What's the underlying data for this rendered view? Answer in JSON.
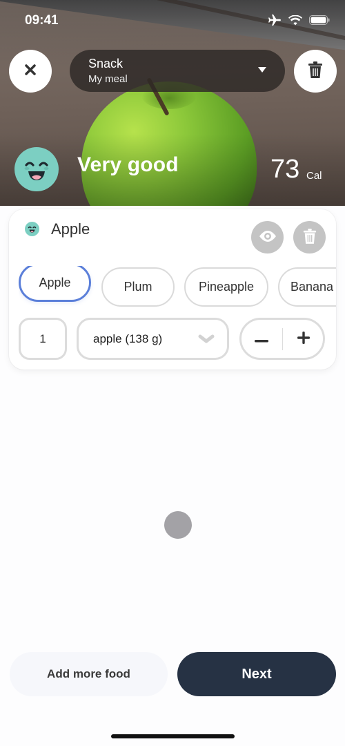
{
  "status_bar": {
    "time": "09:41",
    "icons": [
      "airplane-icon",
      "wifi-icon",
      "battery-icon"
    ]
  },
  "header": {
    "close_icon": "close-icon",
    "meal_type": "Snack",
    "meal_name": "My meal",
    "dropdown_icon": "caret-down-icon",
    "delete_icon": "trash-icon"
  },
  "summary": {
    "rating_icon": "happy-face-icon",
    "rating_label": "Very good",
    "calories": "73",
    "calories_unit": "Cal",
    "rating_color": "#7ccfc2"
  },
  "food_item": {
    "name": "Apple",
    "rating_icon": "happy-face-icon",
    "actions": [
      "eye-icon",
      "trash-icon"
    ],
    "suggestions": [
      {
        "label": "Apple",
        "selected": true
      },
      {
        "label": "Plum",
        "selected": false
      },
      {
        "label": "Pineapple",
        "selected": false
      },
      {
        "label": "Banana",
        "selected": false
      }
    ],
    "quantity": "1",
    "unit": "apple (138 g)",
    "stepper": {
      "minus": "−",
      "plus": "+"
    },
    "selected_color": "#5b7fd9"
  },
  "footer": {
    "add_more_label": "Add more food",
    "next_label": "Next",
    "next_color": "#263244"
  }
}
